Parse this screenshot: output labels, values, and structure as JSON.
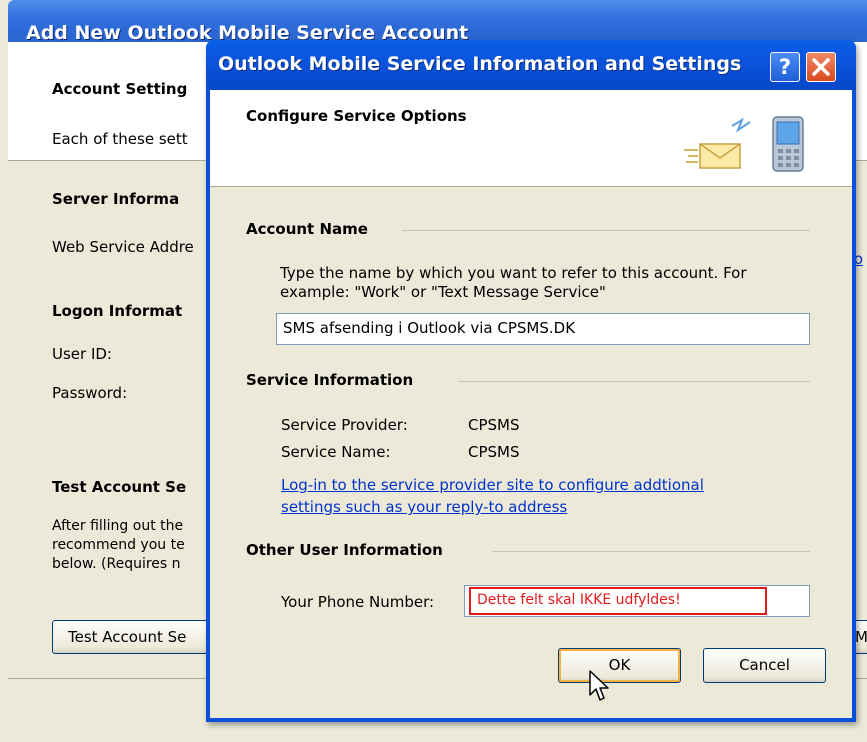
{
  "background_window": {
    "title": "Add New Outlook Mobile Service Account",
    "header_title": "Account Setting",
    "header_desc": "Each of these sett",
    "server_section": "Server Informa",
    "web_service_label": "Web Service Addre",
    "logon_section": "Logon Informat",
    "user_id_label": "User ID:",
    "password_label": "Password:",
    "test_section": "Test Account Se",
    "test_desc_1": "After filling out the",
    "test_desc_2": "recommend you te",
    "test_desc_3": "below. (Requires n",
    "test_button": "Test Account Se",
    "more_button": "M",
    "right_link_fragment": "ro"
  },
  "dialog": {
    "title": "Outlook Mobile Service Information and Settings",
    "help_label": "?",
    "header_title": "Configure Service Options",
    "account_name_section": "Account Name",
    "account_name_desc_1": "Type the name by which you want to refer to this account. For",
    "account_name_desc_2": "example: \"Work\" or \"Text Message Service\"",
    "account_name_value": "SMS afsending i Outlook via CPSMS.DK",
    "service_info_section": "Service Information",
    "provider_label": "Service Provider:",
    "provider_value": "CPSMS",
    "service_name_label": "Service Name:",
    "service_name_value": "CPSMS",
    "link_line_1": "Log-in to the service provider site to configure addtional",
    "link_line_2": "settings such as your reply-to address",
    "other_user_section": "Other User Information",
    "phone_label": "Your Phone Number:",
    "phone_annotation": "Dette felt skal IKKE udfyldes!",
    "ok_button": "OK",
    "cancel_button": "Cancel"
  },
  "colors": {
    "titlebar_blue": "#0b54dc",
    "annotation_red": "#e01b1b",
    "link_blue": "#0033cc"
  },
  "icons": [
    "envelope-icon",
    "mobile-phone-icon",
    "help-icon",
    "close-icon",
    "mouse-cursor-icon"
  ]
}
